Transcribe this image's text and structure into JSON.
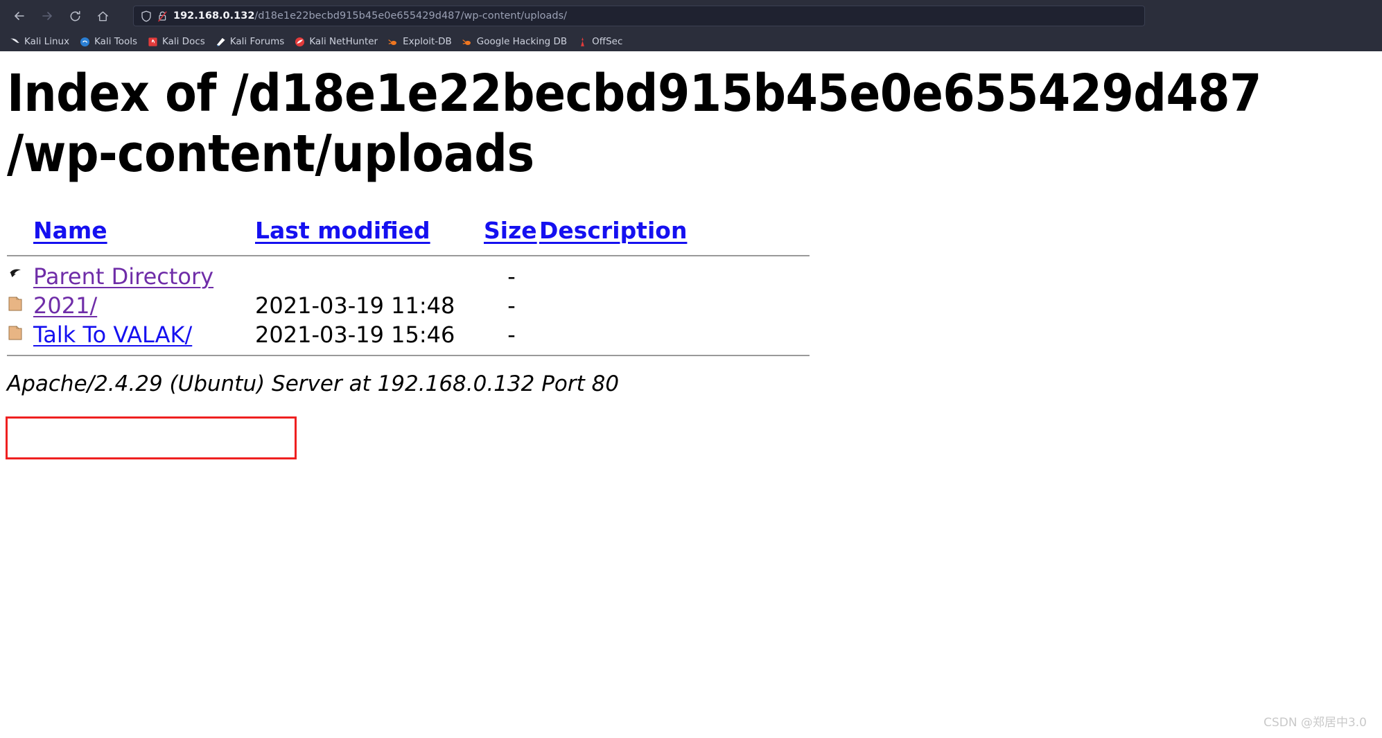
{
  "browser": {
    "nav": {
      "back_label": "back-arrow",
      "forward_label": "forward-arrow",
      "reload_label": "reload",
      "home_label": "home"
    },
    "url": {
      "host": "192.168.0.132",
      "path": "/d18e1e22becbd915b45e0e655429d487/wp-content/uploads/",
      "full": "192.168.0.132/d18e1e22becbd915b45e0e655429d487/wp-content/uploads/",
      "shield_icon": "shield-icon",
      "security_icon": "broken-lock-icon"
    },
    "bookmarks": [
      {
        "label": "Kali Linux",
        "icon": "kali-dragon-icon"
      },
      {
        "label": "Kali Tools",
        "icon": "kali-tools-icon"
      },
      {
        "label": "Kali Docs",
        "icon": "kali-docs-icon"
      },
      {
        "label": "Kali Forums",
        "icon": "kali-forums-icon"
      },
      {
        "label": "Kali NetHunter",
        "icon": "kali-nethunter-icon"
      },
      {
        "label": "Exploit-DB",
        "icon": "exploit-db-icon"
      },
      {
        "label": "Google Hacking DB",
        "icon": "google-hacking-db-icon"
      },
      {
        "label": "OffSec",
        "icon": "offsec-icon"
      }
    ]
  },
  "page": {
    "heading_line1": "Index of /d18e1e22becbd915b45e0e655429d487",
    "heading_line2": "/wp-content/uploads",
    "table": {
      "headers": {
        "icon": "",
        "name": "Name",
        "last_modified": "Last modified",
        "size": "Size",
        "description": "Description"
      },
      "rows": [
        {
          "icon": "parent-directory-icon",
          "name": "Parent Directory",
          "link_state": "visited",
          "last_modified": "",
          "size": "-",
          "description": ""
        },
        {
          "icon": "folder-icon",
          "name": "2021/",
          "link_state": "visited",
          "last_modified": "2021-03-19 11:48",
          "size": "-",
          "description": ""
        },
        {
          "icon": "folder-icon",
          "name": "Talk To VALAK/",
          "link_state": "unvisited",
          "last_modified": "2021-03-19 15:46",
          "size": "-",
          "description": ""
        }
      ]
    },
    "footer": "Apache/2.4.29 (Ubuntu) Server at 192.168.0.132 Port 80"
  },
  "annotation": {
    "highlight_row_index": 2,
    "color": "#ef2020"
  },
  "watermark": "CSDN @郑居中3.0",
  "colors": {
    "chrome_bg": "#2b2e3b",
    "url_bg": "#1f2230",
    "link_unvisited": "#1510f0",
    "link_visited": "#6f2da8",
    "annotation_red": "#ef2020"
  }
}
